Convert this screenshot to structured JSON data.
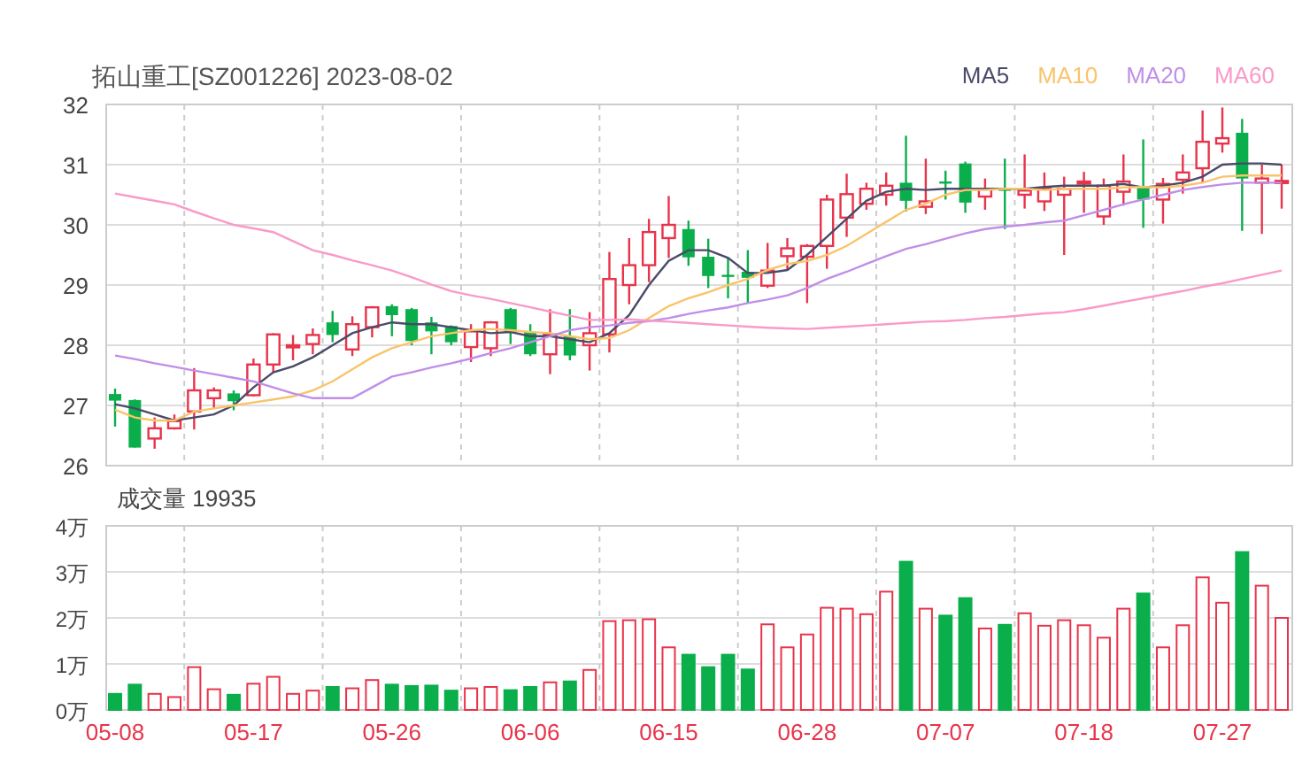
{
  "price_chart": {
    "chart_data": {
      "type": "candlestick",
      "title": "拓山重工[SZ001226] 2023-08-02",
      "ylim": [
        26,
        32
      ],
      "yticks": [
        26,
        27,
        28,
        29,
        30,
        31,
        32
      ],
      "grid": true,
      "categories": [
        null,
        null,
        null,
        null,
        null,
        null,
        null,
        null,
        null,
        null,
        null,
        null,
        null,
        null,
        null,
        null,
        null,
        null,
        null,
        null,
        null,
        null,
        null,
        null,
        null,
        null,
        null,
        null,
        null,
        null,
        null,
        null,
        null,
        null,
        null,
        null,
        null,
        null,
        null,
        null,
        null,
        null,
        null,
        null,
        null,
        null,
        null,
        null,
        null,
        null,
        null,
        null,
        null,
        null,
        null,
        null,
        null,
        null,
        null,
        null
      ],
      "ohlc": [
        [
          27.19,
          27.28,
          26.65,
          27.08
        ],
        [
          27.09,
          27.1,
          26.3,
          26.3
        ],
        [
          26.45,
          26.8,
          26.28,
          26.62
        ],
        [
          26.62,
          26.85,
          26.6,
          26.74
        ],
        [
          26.9,
          27.62,
          26.6,
          27.25
        ],
        [
          27.12,
          27.3,
          26.95,
          27.25
        ],
        [
          27.2,
          27.25,
          26.92,
          27.07
        ],
        [
          27.17,
          27.78,
          27.15,
          27.68
        ],
        [
          27.68,
          28.2,
          27.55,
          28.18
        ],
        [
          27.99,
          28.17,
          27.75,
          28.0
        ],
        [
          28.02,
          28.28,
          27.85,
          28.17
        ],
        [
          28.38,
          28.57,
          28.05,
          28.17
        ],
        [
          27.93,
          28.48,
          27.82,
          28.35
        ],
        [
          28.3,
          28.65,
          28.13,
          28.63
        ],
        [
          28.65,
          28.68,
          28.15,
          28.5
        ],
        [
          28.6,
          28.62,
          28.0,
          28.07
        ],
        [
          28.38,
          28.47,
          27.85,
          28.23
        ],
        [
          28.32,
          28.33,
          28.0,
          28.05
        ],
        [
          27.97,
          28.35,
          27.72,
          28.23
        ],
        [
          27.95,
          28.4,
          27.82,
          28.38
        ],
        [
          28.6,
          28.62,
          28.02,
          28.22
        ],
        [
          28.22,
          28.35,
          27.82,
          27.85
        ],
        [
          27.85,
          28.6,
          27.52,
          28.18
        ],
        [
          28.15,
          28.6,
          27.75,
          27.83
        ],
        [
          28.0,
          28.55,
          27.58,
          28.2
        ],
        [
          28.18,
          29.55,
          27.88,
          29.1
        ],
        [
          29.0,
          29.78,
          28.68,
          29.33
        ],
        [
          29.33,
          30.1,
          29.05,
          29.88
        ],
        [
          29.78,
          30.48,
          29.45,
          30.0
        ],
        [
          29.93,
          30.07,
          29.32,
          29.46
        ],
        [
          29.47,
          29.77,
          28.95,
          29.15
        ],
        [
          29.17,
          29.45,
          28.78,
          29.15
        ],
        [
          29.22,
          29.58,
          28.7,
          29.12
        ],
        [
          28.99,
          29.7,
          28.95,
          29.24
        ],
        [
          29.48,
          29.78,
          29.25,
          29.61
        ],
        [
          29.47,
          29.68,
          28.7,
          29.65
        ],
        [
          29.65,
          30.5,
          29.27,
          30.42
        ],
        [
          30.12,
          30.85,
          29.8,
          30.51
        ],
        [
          30.35,
          30.7,
          30.25,
          30.6
        ],
        [
          30.5,
          30.87,
          30.32,
          30.65
        ],
        [
          30.7,
          31.48,
          30.22,
          30.4
        ],
        [
          30.3,
          31.1,
          30.18,
          30.39
        ],
        [
          30.72,
          30.9,
          30.42,
          30.7
        ],
        [
          31.02,
          31.05,
          30.2,
          30.37
        ],
        [
          30.47,
          30.77,
          30.25,
          30.6
        ],
        [
          30.6,
          31.1,
          29.93,
          30.57
        ],
        [
          30.5,
          31.17,
          30.27,
          30.57
        ],
        [
          30.39,
          30.87,
          30.23,
          30.6
        ],
        [
          30.5,
          30.8,
          29.5,
          30.6
        ],
        [
          30.7,
          30.88,
          30.2,
          30.72
        ],
        [
          30.14,
          30.77,
          30.0,
          30.65
        ],
        [
          30.55,
          31.17,
          30.32,
          30.72
        ],
        [
          30.62,
          31.42,
          29.95,
          30.42
        ],
        [
          30.42,
          30.78,
          30.02,
          30.68
        ],
        [
          30.75,
          31.17,
          30.52,
          30.87
        ],
        [
          30.94,
          31.9,
          30.7,
          31.38
        ],
        [
          31.35,
          31.95,
          31.2,
          31.44
        ],
        [
          31.53,
          31.76,
          29.9,
          30.77
        ],
        [
          30.7,
          31.0,
          29.85,
          30.77
        ],
        [
          30.72,
          31.0,
          30.27,
          30.73
        ]
      ],
      "series": [
        {
          "name": "MA5",
          "type": "line",
          "color": "#4a4a6a",
          "values": [
            27.02,
            26.95,
            26.85,
            26.75,
            26.8,
            26.85,
            27.0,
            27.3,
            27.55,
            27.65,
            27.8,
            28.0,
            28.2,
            28.3,
            28.38,
            28.35,
            28.35,
            28.3,
            28.25,
            28.2,
            28.22,
            28.15,
            28.15,
            28.1,
            28.05,
            28.2,
            28.5,
            29.0,
            29.4,
            29.58,
            29.58,
            29.45,
            29.2,
            29.2,
            29.25,
            29.5,
            29.8,
            30.1,
            30.4,
            30.55,
            30.6,
            30.58,
            30.6,
            30.6,
            30.6,
            30.6,
            30.6,
            30.63,
            30.65,
            30.65,
            30.65,
            30.68,
            30.62,
            30.65,
            30.7,
            30.8,
            31.0,
            31.02,
            31.02,
            31.0
          ]
        },
        {
          "name": "MA10",
          "type": "line",
          "color": "#f9c46b",
          "values": [
            26.93,
            26.8,
            26.75,
            26.75,
            26.9,
            26.95,
            27.0,
            27.05,
            27.1,
            27.15,
            27.25,
            27.4,
            27.6,
            27.8,
            27.95,
            28.05,
            28.15,
            28.2,
            28.25,
            28.27,
            28.25,
            28.22,
            28.2,
            28.15,
            28.1,
            28.12,
            28.25,
            28.45,
            28.65,
            28.78,
            28.88,
            29.0,
            29.1,
            29.25,
            29.35,
            29.4,
            29.5,
            29.65,
            29.85,
            30.05,
            30.25,
            30.35,
            30.5,
            30.58,
            30.58,
            30.6,
            30.6,
            30.58,
            30.6,
            30.6,
            30.6,
            30.62,
            30.63,
            30.62,
            30.65,
            30.7,
            30.8,
            30.82,
            30.82,
            30.82
          ]
        },
        {
          "name": "MA20",
          "type": "line",
          "color": "#c08ee8",
          "values": [
            27.83,
            27.77,
            27.7,
            27.64,
            27.58,
            27.52,
            27.46,
            27.4,
            27.3,
            27.2,
            27.12,
            27.12,
            27.12,
            27.3,
            27.48,
            27.55,
            27.63,
            27.7,
            27.78,
            27.87,
            27.95,
            28.05,
            28.15,
            28.25,
            28.3,
            28.33,
            28.37,
            28.4,
            28.45,
            28.52,
            28.58,
            28.63,
            28.7,
            28.76,
            28.83,
            28.95,
            29.1,
            29.22,
            29.35,
            29.48,
            29.6,
            29.68,
            29.77,
            29.86,
            29.93,
            29.97,
            30.0,
            30.04,
            30.07,
            30.16,
            30.25,
            30.34,
            30.42,
            30.5,
            30.58,
            30.63,
            30.67,
            30.7,
            30.7,
            30.7
          ]
        },
        {
          "name": "MA60",
          "type": "line",
          "color": "#f99ac8",
          "values": [
            30.52,
            30.46,
            30.4,
            30.34,
            30.22,
            30.11,
            30.0,
            29.94,
            29.88,
            29.73,
            29.58,
            29.5,
            29.41,
            29.33,
            29.24,
            29.13,
            29.01,
            28.9,
            28.83,
            28.77,
            28.7,
            28.63,
            28.56,
            28.49,
            28.42,
            28.42,
            28.43,
            28.41,
            28.39,
            28.37,
            28.35,
            28.33,
            28.31,
            28.29,
            28.28,
            28.27,
            28.29,
            28.31,
            28.33,
            28.35,
            28.37,
            28.39,
            28.4,
            28.42,
            28.45,
            28.47,
            28.5,
            28.53,
            28.55,
            28.6,
            28.66,
            28.72,
            28.78,
            28.84,
            28.9,
            28.97,
            29.03,
            29.1,
            29.17,
            29.24
          ]
        }
      ]
    }
  },
  "volume_chart": {
    "chart_data": {
      "type": "bar",
      "title": "成交量 19935",
      "ylim": [
        0,
        4
      ],
      "grid": true,
      "categories": [
        "05-08",
        null,
        null,
        null,
        null,
        null,
        null,
        "05-17",
        null,
        null,
        null,
        null,
        null,
        null,
        "05-26",
        null,
        null,
        null,
        null,
        null,
        null,
        "06-06",
        null,
        null,
        null,
        null,
        null,
        null,
        "06-15",
        null,
        null,
        null,
        null,
        null,
        null,
        "06-28",
        null,
        null,
        null,
        null,
        null,
        null,
        "07-07",
        null,
        null,
        null,
        null,
        null,
        null,
        "07-18",
        null,
        null,
        null,
        null,
        null,
        null,
        "07-27",
        null,
        null,
        null
      ],
      "yticks": [
        {
          "value": 0,
          "label": "0万"
        },
        {
          "value": 1,
          "label": "1万"
        },
        {
          "value": 2,
          "label": "2万"
        },
        {
          "value": 3,
          "label": "3万"
        },
        {
          "value": 4,
          "label": "4万"
        }
      ],
      "series": [
        {
          "values": [
            0.35,
            0.55,
            0.35,
            0.28,
            0.93,
            0.45,
            0.33,
            0.57,
            0.72,
            0.35,
            0.42,
            0.5,
            0.47,
            0.65,
            0.55,
            0.52,
            0.53,
            0.42,
            0.47,
            0.5,
            0.43,
            0.5,
            0.6,
            0.62,
            0.87,
            1.93,
            1.95,
            1.97,
            1.36,
            1.2,
            0.93,
            1.2,
            0.88,
            1.86,
            1.36,
            1.64,
            2.22,
            2.2,
            2.08,
            2.57,
            3.22,
            2.2,
            2.05,
            2.43,
            1.77,
            1.85,
            2.1,
            1.83,
            1.95,
            1.84,
            1.57,
            2.2,
            2.53,
            1.36,
            1.84,
            2.88,
            2.33,
            3.43,
            2.7,
            2.0
          ]
        }
      ]
    }
  }
}
